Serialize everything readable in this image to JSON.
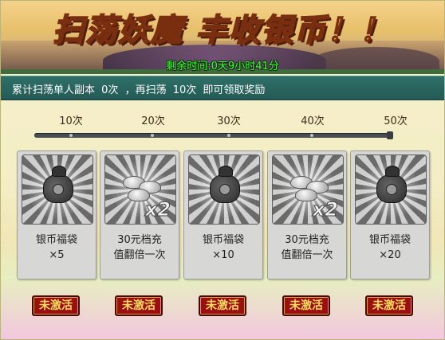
{
  "banner": {
    "title": "扫荡妖魔 丰收银币！！",
    "timer": "剩余时间:0天9小时41分"
  },
  "info": {
    "prefix": "累计扫荡单人副本",
    "done": "0次",
    "mid": "，再扫荡",
    "remain": "10次",
    "suffix": "即可领取奖励"
  },
  "progress": {
    "milestones": [
      "10次",
      "20次",
      "30次",
      "40次",
      "50次"
    ],
    "completed_fraction": 0
  },
  "rewards": [
    {
      "icon": "coin-bag-icon",
      "line1": "银币福袋",
      "line2": "×5",
      "status": "未激活"
    },
    {
      "icon": "silver-ingot-icon",
      "badge": "x2",
      "line1": "30元档充",
      "line2": "值翻倍一次",
      "status": "未激活"
    },
    {
      "icon": "coin-bag-icon",
      "line1": "银币福袋",
      "line2": "×10",
      "status": "未激活"
    },
    {
      "icon": "silver-ingot-icon",
      "badge": "x2",
      "line1": "30元档充",
      "line2": "值翻倍一次",
      "status": "未激活"
    },
    {
      "icon": "coin-bag-icon",
      "line1": "银币福袋",
      "line2": "×20",
      "status": "未激活"
    }
  ],
  "colors": {
    "timer": "#41ff33",
    "stamp": "#9a0f0f",
    "stamp_text": "#ffdc61",
    "strip": "#2f6f68"
  }
}
